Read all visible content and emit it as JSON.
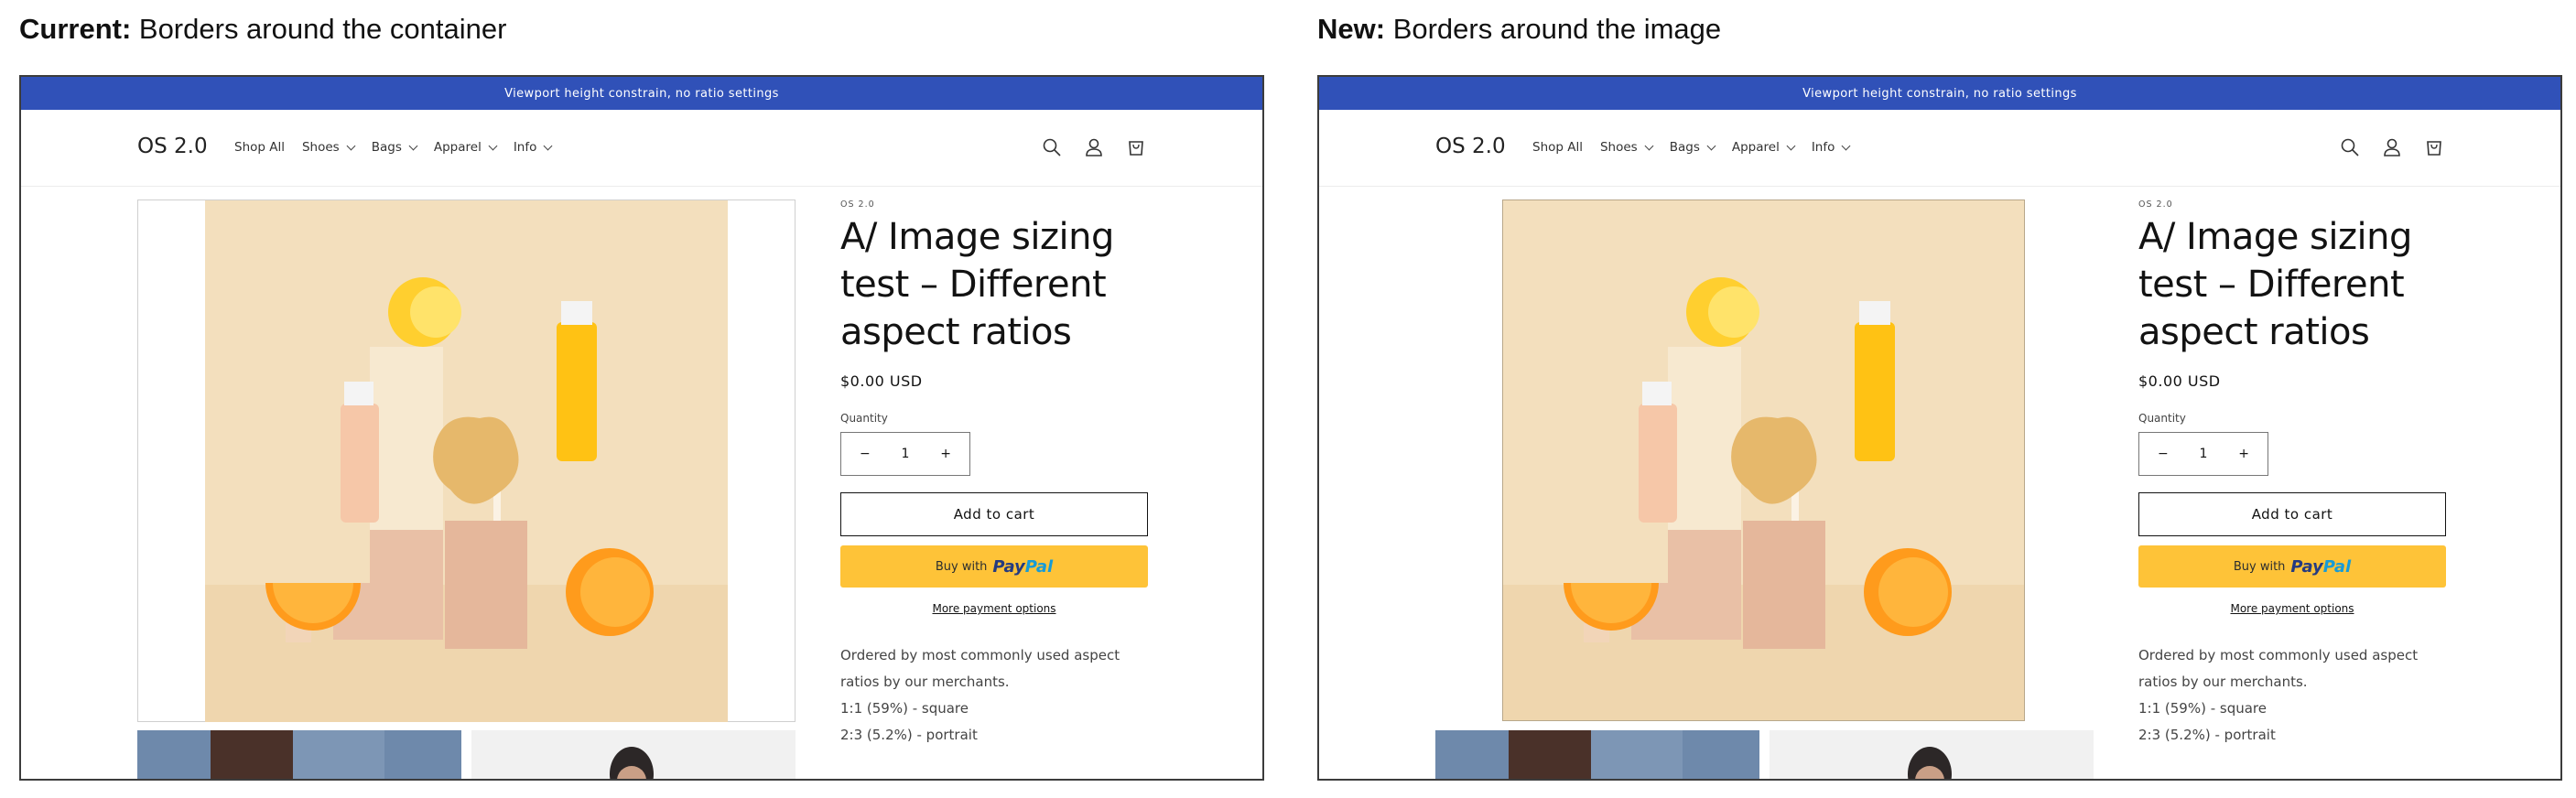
{
  "captions": {
    "left_bold": "Current:",
    "left_rest": " Borders around the container",
    "right_bold": "New:",
    "right_rest": " Borders around the image"
  },
  "store": {
    "announcement": "Viewport height constrain, no ratio settings",
    "logo": "OS 2.0",
    "nav": [
      "Shop All",
      "Shoes",
      "Bags",
      "Apparel",
      "Info"
    ],
    "icons": [
      "search-icon",
      "account-icon",
      "cart-icon"
    ]
  },
  "product": {
    "vendor": "OS 2.0",
    "title": "A/ Image sizing test – Different aspect ratios",
    "price": "$0.00 USD",
    "quantity_label": "Quantity",
    "quantity_value": "1",
    "minus": "−",
    "plus": "+",
    "add_to_cart": "Add to cart",
    "buy_with": "Buy with",
    "paypal_1": "Pay",
    "paypal_2": "Pal",
    "more_payment": "More payment options",
    "description": "Ordered by most commonly used aspect ratios by our merchants.",
    "ratios": [
      "1:1 (59%) - square",
      "2:3 (5.2%) - portrait"
    ]
  },
  "colors": {
    "announcement_bg": "#3051b8",
    "paypal_button": "#fec338",
    "image_bg": "#f3dfbd"
  }
}
